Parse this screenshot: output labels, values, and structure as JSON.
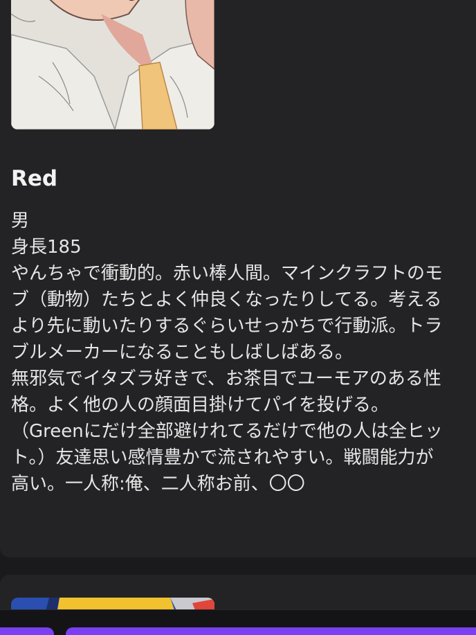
{
  "character": {
    "name": "Red",
    "profile_lines": [
      "男",
      "身長185",
      "やんちゃで衝動的。赤い棒人間。マインクラフトのモ",
      "ブ（動物）たちとよく仲良くなったりしてる。考える",
      "より先に動いたりするぐらいせっかちで行動派。トラ",
      "ブルメーカーになることもしばしばある。",
      "無邪気でイタズラ好きで、お茶目でユーモアのある性",
      "格。よく他の人の顔面目掛けてパイを投げる。",
      "（Greenにだけ全部避けれてるだけで他の人は全ヒッ",
      "ト。）友達思い感情豊かで流されやすい。戦闘能力が",
      "高い。一人称:俺、二人称お前、〇〇"
    ]
  },
  "colors": {
    "background": "#1a1a1c",
    "card": "#232325",
    "accent": "#7b3ff2",
    "text": "#e6e6e6"
  },
  "icons": {
    "portrait": "character-portrait-image",
    "next_thumbnail": "character-thumbnail-image"
  }
}
